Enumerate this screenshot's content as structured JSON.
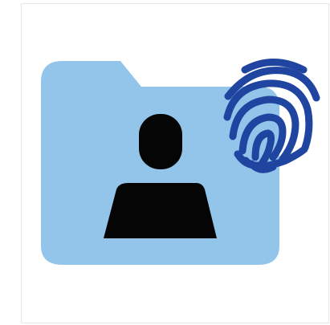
{
  "illustration": {
    "subject_icon": "user-profile-folder-icon",
    "overlay_icon": "fingerprint-icon",
    "colors": {
      "background": "#ffffff",
      "frame_border": "#e6e6e6",
      "folder": "#93c5ea",
      "person": "#050505",
      "fingerprint": "#1f45a0"
    }
  }
}
